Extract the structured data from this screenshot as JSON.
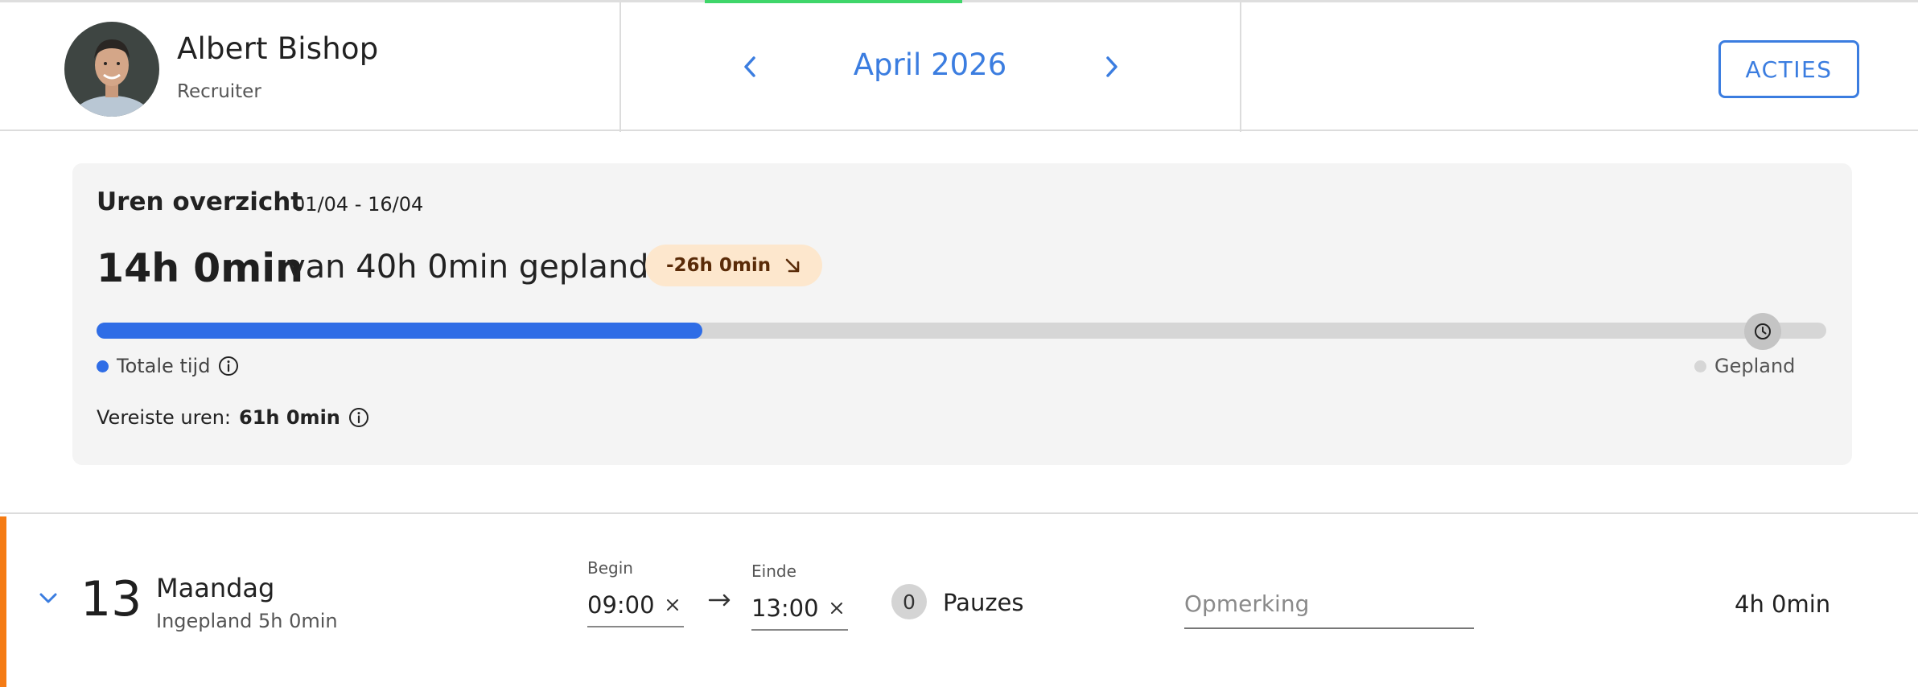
{
  "header": {
    "user": {
      "name": "Albert Bishop",
      "role": "Recruiter"
    },
    "month": {
      "label": "April 2026"
    },
    "actions_label": "ACTIES"
  },
  "overview": {
    "title": "Uren overzicht",
    "range": "01/04 - 16/04",
    "total": "14h 0min",
    "planned_text": "van 40h 0min gepland",
    "delta": "-26h 0min",
    "progress_fraction": 0.35,
    "legend_total": "Totale tijd",
    "legend_planned": "Gepland",
    "required_label": "Vereiste uren:",
    "required_value": "61h 0min",
    "colors": {
      "total": "#2f6de6",
      "planned": "#d6d6d6",
      "delta_bg": "#fde7cd"
    }
  },
  "day": {
    "number": "13",
    "name": "Maandag",
    "planned": "Ingepland 5h 0min",
    "begin_label": "Begin",
    "begin_value": "09:00",
    "end_label": "Einde",
    "end_value": "13:00",
    "pauses_count": "0",
    "pauses_label": "Pauzes",
    "remark_placeholder": "Opmerking",
    "total": "4h 0min",
    "accent_color": "#f57b14"
  }
}
